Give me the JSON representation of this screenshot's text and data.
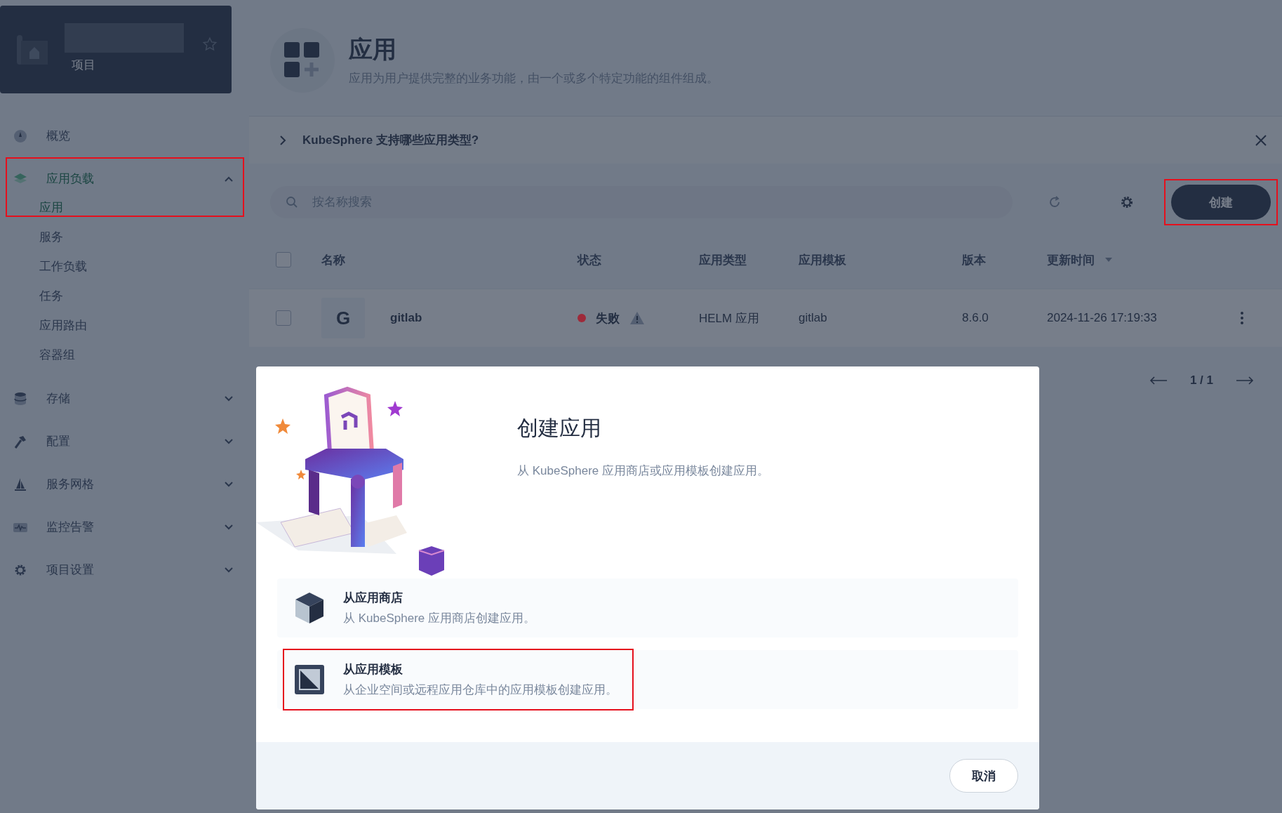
{
  "sidebar": {
    "project_label": "项目",
    "starred": false,
    "items": [
      {
        "kind": "overview",
        "label": "概览",
        "selected": false,
        "highlighted": false
      },
      {
        "kind": "workload",
        "label": "应用负载",
        "selected": true,
        "expanded": true,
        "highlighted": true,
        "children": [
          {
            "label": "应用",
            "selected": true
          },
          {
            "label": "服务",
            "selected": false
          },
          {
            "label": "工作负载",
            "selected": false
          },
          {
            "label": "任务",
            "selected": false
          },
          {
            "label": "应用路由",
            "selected": false
          },
          {
            "label": "容器组",
            "selected": false
          }
        ]
      },
      {
        "kind": "storage",
        "label": "存储",
        "selected": false,
        "expanded": false,
        "highlighted": false
      },
      {
        "kind": "config",
        "label": "配置",
        "selected": false,
        "expanded": false,
        "highlighted": false
      },
      {
        "kind": "mesh",
        "label": "服务网格",
        "selected": false,
        "expanded": false,
        "highlighted": false
      },
      {
        "kind": "monitor",
        "label": "监控告警",
        "selected": false,
        "expanded": false,
        "highlighted": false
      },
      {
        "kind": "settings",
        "label": "项目设置",
        "selected": false,
        "expanded": false,
        "highlighted": false
      }
    ]
  },
  "header": {
    "title": "应用",
    "description": "应用为用户提供完整的业务功能，由一个或多个特定功能的组件组成。"
  },
  "info_banner": {
    "text": "KubeSphere 支持哪些应用类型?",
    "expanded": false
  },
  "toolbar": {
    "search": {
      "placeholder": "按名称搜索"
    },
    "create_button": {
      "label": "创建",
      "highlighted": true
    }
  },
  "table": {
    "select_all_checked": false,
    "columns": [
      {
        "label": "名称",
        "sorted": false
      },
      {
        "label": "状态",
        "sorted": false
      },
      {
        "label": "应用类型",
        "sorted": false
      },
      {
        "label": "应用模板",
        "sorted": false
      },
      {
        "label": "版本",
        "sorted": false
      },
      {
        "label": "更新时间",
        "sorted": true
      }
    ],
    "rows": [
      {
        "checked": false,
        "avatar": "G",
        "name": "gitlab",
        "status": "失败",
        "color": "#9e2a3a",
        "warning": true,
        "type": "HELM 应用",
        "template": "gitlab",
        "version": "8.6.0",
        "updated": "2024-11-26 17:19:33"
      }
    ]
  },
  "pagination": {
    "page": "1 / 1"
  },
  "dialog": {
    "title": "创建应用",
    "description": "从 KubeSphere 应用商店或应用模板创建应用。",
    "options": [
      {
        "kind": "store",
        "title": "从应用商店",
        "description": "从 KubeSphere 应用商店创建应用。",
        "highlighted": false
      },
      {
        "kind": "template",
        "title": "从应用模板",
        "description": "从企业空间或远程应用仓库中的应用模板创建应用。",
        "highlighted": true
      }
    ],
    "cancel_button": "取消"
  }
}
